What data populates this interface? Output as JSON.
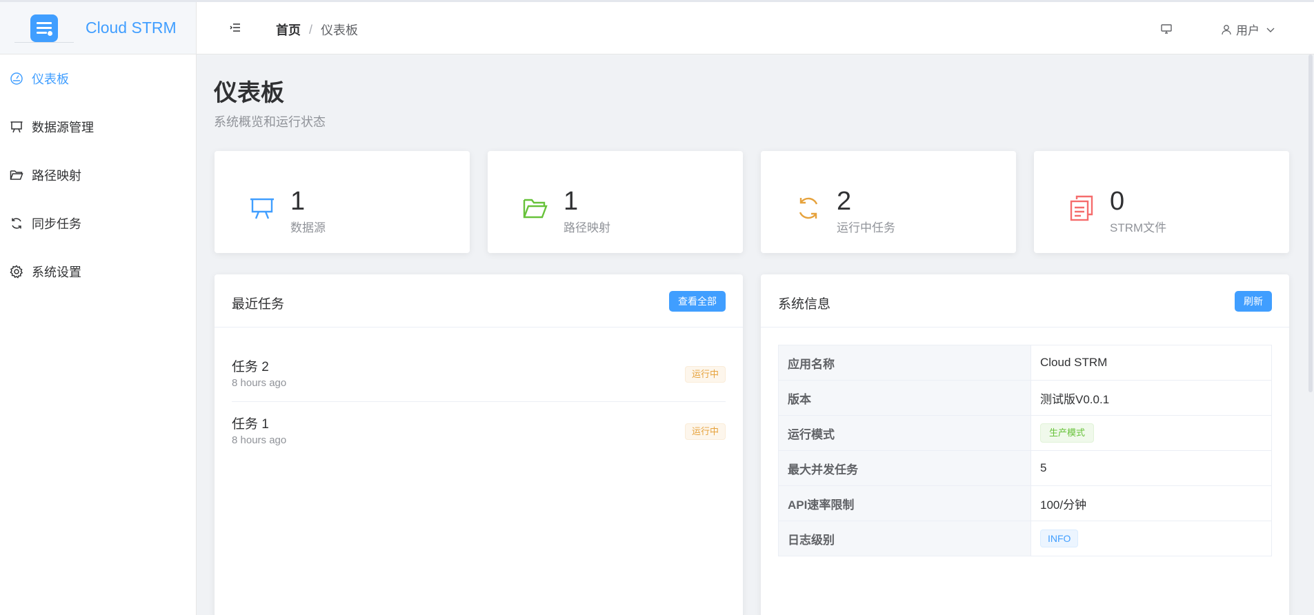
{
  "app": {
    "name": "Cloud STRM"
  },
  "sidebar": {
    "items": [
      {
        "label": "仪表板",
        "icon": "dashboard-gauge-icon",
        "active": true
      },
      {
        "label": "数据源管理",
        "icon": "presentation-board-icon",
        "active": false
      },
      {
        "label": "路径映射",
        "icon": "folder-open-icon",
        "active": false
      },
      {
        "label": "同步任务",
        "icon": "refresh-icon",
        "active": false
      },
      {
        "label": "系统设置",
        "icon": "gear-icon",
        "active": false
      }
    ]
  },
  "header": {
    "breadcrumb": {
      "home": "首页",
      "separator": "/",
      "current": "仪表板"
    },
    "user_label": "用户"
  },
  "page": {
    "title": "仪表板",
    "subtitle": "系统概览和运行状态"
  },
  "stats": [
    {
      "value": "1",
      "label": "数据源",
      "icon": "presentation-board-icon",
      "color": "#409eff"
    },
    {
      "value": "1",
      "label": "路径映射",
      "icon": "folder-open-icon",
      "color": "#67c23a"
    },
    {
      "value": "2",
      "label": "运行中任务",
      "icon": "refresh-icon",
      "color": "#e6a23c"
    },
    {
      "value": "0",
      "label": "STRM文件",
      "icon": "documents-copy-icon",
      "color": "#f56c6c"
    }
  ],
  "recent_tasks": {
    "title": "最近任务",
    "view_all_label": "查看全部",
    "items": [
      {
        "name": "任务 2",
        "time": "8 hours ago",
        "status": "运行中"
      },
      {
        "name": "任务 1",
        "time": "8 hours ago",
        "status": "运行中"
      }
    ]
  },
  "system_info": {
    "title": "系统信息",
    "refresh_label": "刷新",
    "rows": [
      {
        "key": "应用名称",
        "value": "Cloud STRM"
      },
      {
        "key": "版本",
        "value": "测试版V0.0.1"
      },
      {
        "key": "运行模式",
        "value": "生产模式"
      },
      {
        "key": "最大并发任务",
        "value": "5"
      },
      {
        "key": "API速率限制",
        "value": "100/分钟"
      },
      {
        "key": "日志级别",
        "value": "INFO"
      }
    ]
  },
  "colors": {
    "accent": "#409eff",
    "success": "#67c23a",
    "warning": "#e6a23c",
    "danger": "#f56c6c"
  }
}
